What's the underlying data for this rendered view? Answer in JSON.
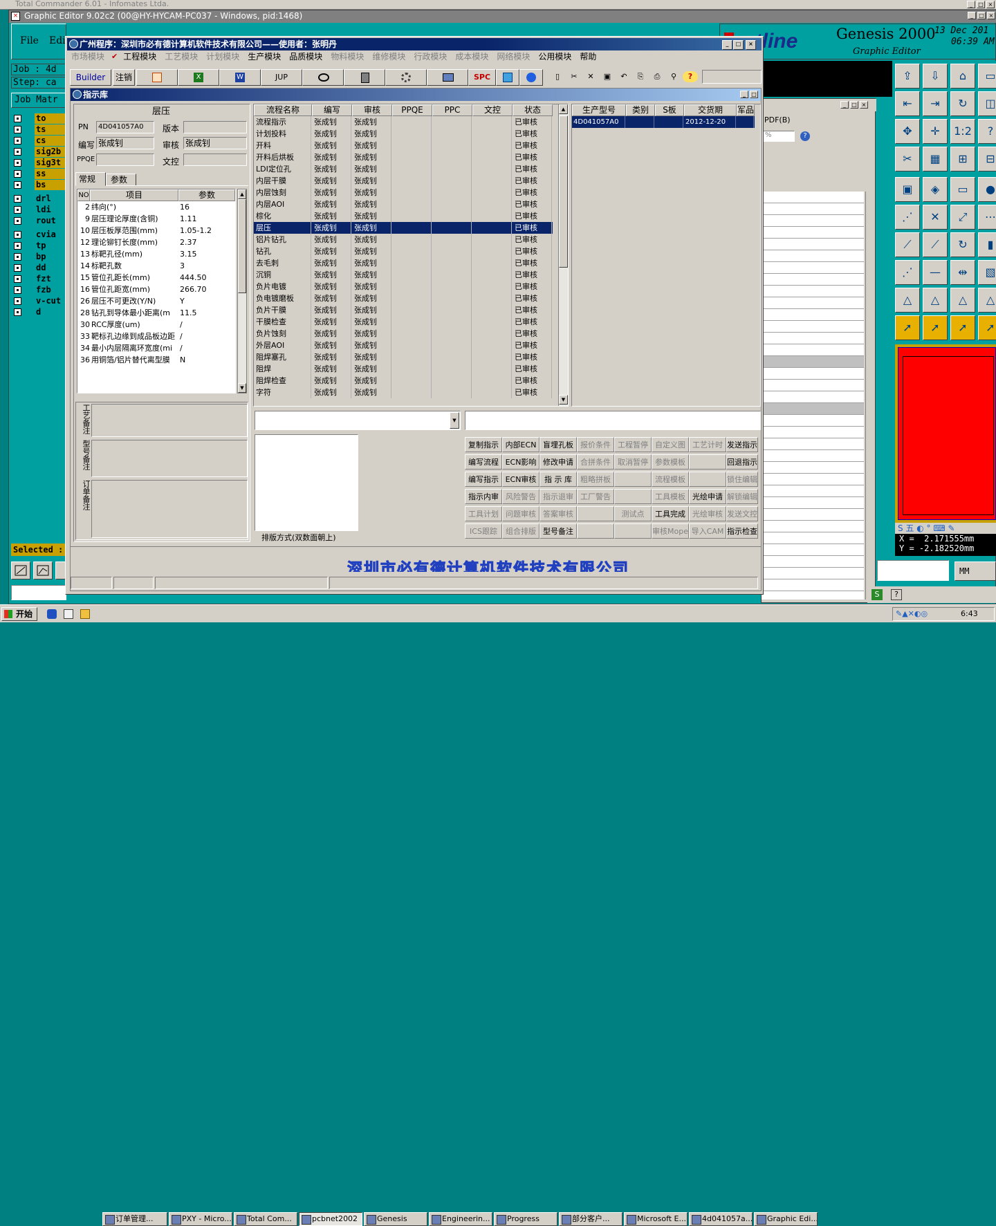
{
  "bg_window": {
    "title": "Total Commander 6.01 - Infomates Ltda."
  },
  "genesis": {
    "title": "Graphic Editor 9.02c2 (00@HY-HYCAM-PC037 - Windows, pid:1468)",
    "menu": [
      "File",
      "Edi"
    ],
    "job_label": "Job : 4d",
    "step_label": "Step: ca",
    "job_matrix": "Job Matr",
    "layers": [
      "to",
      "ts",
      "cs",
      "sig2b",
      "sig3t",
      "ss",
      "bs",
      "drl",
      "ldi",
      "rout",
      "cvia",
      "tp",
      "bp",
      "dd",
      "fzt",
      "fzb",
      "v-cut",
      "d"
    ],
    "selected": "Selected :",
    "logo": "ontline",
    "product": "Genesis 2000",
    "subtitle": "Graphic Editor",
    "date": "13 Dec 201",
    "time": "06:39 AM",
    "coord_x": "X =  2.171555mm",
    "coord_y": "Y = -2.182520mm",
    "units": "MM"
  },
  "pdf_window": {
    "label": "PDF(B)",
    "zoom": "%"
  },
  "app": {
    "title": "广州程序：深圳市必有德计算机软件技术有限公司——使用者：张明丹",
    "menu": [
      {
        "label": "市场模块",
        "enabled": false
      },
      {
        "label": "工程模块",
        "enabled": true
      },
      {
        "label": "工艺模块",
        "enabled": false
      },
      {
        "label": "计划模块",
        "enabled": false
      },
      {
        "label": "生产模块",
        "enabled": true
      },
      {
        "label": "品质模块",
        "enabled": true
      },
      {
        "label": "物料模块",
        "enabled": false
      },
      {
        "label": "维修模块",
        "enabled": false
      },
      {
        "label": "行政模块",
        "enabled": false
      },
      {
        "label": "成本模块",
        "enabled": false
      },
      {
        "label": "网络模块",
        "enabled": false
      },
      {
        "label": "公用模块",
        "enabled": true
      },
      {
        "label": "帮助",
        "enabled": true
      }
    ],
    "toolbar": {
      "builder": "Builder",
      "logout": "注销",
      "jup": "JUP",
      "spc": "SPC"
    },
    "footer": "深圳市必有德计算机软件技术有限公司"
  },
  "inner": {
    "title": "指示库",
    "section_title": "层压",
    "pn_label": "PN",
    "pn_value": "4D041057A0",
    "version_label": "版本",
    "version_value": "",
    "author_label": "编写",
    "author_value": "张成钊",
    "review_label": "审核",
    "review_value": "张成钊",
    "ppqe_label": "PPQE",
    "ppqe_value": "",
    "doc_label": "文控",
    "doc_value": "",
    "tabs": [
      "常规",
      "参数"
    ],
    "param_headers": [
      "NO",
      "项目",
      "参数"
    ],
    "params": [
      [
        "2",
        "纬向(°)",
        "16"
      ],
      [
        "9",
        "层压理论厚度(含铜)",
        "1.11"
      ],
      [
        "10",
        "层压板厚范围(mm)",
        "1.05-1.2"
      ],
      [
        "12",
        "理论铆钉长度(mm)",
        "2.37"
      ],
      [
        "13",
        "标靶孔径(mm)",
        "3.15"
      ],
      [
        "14",
        "标靶孔数",
        "3"
      ],
      [
        "15",
        "管位孔距长(mm)",
        "444.50"
      ],
      [
        "16",
        "管位孔距宽(mm)",
        "266.70"
      ],
      [
        "26",
        "层压不可更改(Y/N)",
        "Y"
      ],
      [
        "28",
        "钻孔到导体最小距离(m",
        "11.5"
      ],
      [
        "30",
        "RCC厚度(um)",
        "/"
      ],
      [
        "33",
        "靶标孔边缘到成品板边距",
        "/"
      ],
      [
        "34",
        "最小内层隔离环宽度(mi",
        "/"
      ],
      [
        "36",
        "用铜箔/铝片替代离型膜",
        "N"
      ]
    ],
    "note1": "工艺备注",
    "note2": "型号备注",
    "note3": "订单备注",
    "flow_headers": [
      "流程名称",
      "编写",
      "审核",
      "PPQE",
      "PPC",
      "文控",
      "状态"
    ],
    "flows": [
      [
        "流程指示",
        "张成钊",
        "张成钊",
        "",
        "",
        "",
        "已审核"
      ],
      [
        "计划投料",
        "张成钊",
        "张成钊",
        "",
        "",
        "",
        "已审核"
      ],
      [
        "开料",
        "张成钊",
        "张成钊",
        "",
        "",
        "",
        "已审核"
      ],
      [
        "开料后烘板",
        "张成钊",
        "张成钊",
        "",
        "",
        "",
        "已审核"
      ],
      [
        "LDI定位孔",
        "张成钊",
        "张成钊",
        "",
        "",
        "",
        "已审核"
      ],
      [
        "内层干膜",
        "张成钊",
        "张成钊",
        "",
        "",
        "",
        "已审核"
      ],
      [
        "内层蚀刻",
        "张成钊",
        "张成钊",
        "",
        "",
        "",
        "已审核"
      ],
      [
        "内层AOI",
        "张成钊",
        "张成钊",
        "",
        "",
        "",
        "已审核"
      ],
      [
        "棕化",
        "张成钊",
        "张成钊",
        "",
        "",
        "",
        "已审核"
      ],
      [
        "层压",
        "张成钊",
        "张成钊",
        "",
        "",
        "",
        "已审核"
      ],
      [
        "铝片钻孔",
        "张成钊",
        "张成钊",
        "",
        "",
        "",
        "已审核"
      ],
      [
        "钻孔",
        "张成钊",
        "张成钊",
        "",
        "",
        "",
        "已审核"
      ],
      [
        "去毛刺",
        "张成钊",
        "张成钊",
        "",
        "",
        "",
        "已审核"
      ],
      [
        "沉铜",
        "张成钊",
        "张成钊",
        "",
        "",
        "",
        "已审核"
      ],
      [
        "负片电镀",
        "张成钊",
        "张成钊",
        "",
        "",
        "",
        "已审核"
      ],
      [
        "负电镀磨板",
        "张成钊",
        "张成钊",
        "",
        "",
        "",
        "已审核"
      ],
      [
        "负片干膜",
        "张成钊",
        "张成钊",
        "",
        "",
        "",
        "已审核"
      ],
      [
        "干膜检查",
        "张成钊",
        "张成钊",
        "",
        "",
        "",
        "已审核"
      ],
      [
        "负片蚀刻",
        "张成钊",
        "张成钊",
        "",
        "",
        "",
        "已审核"
      ],
      [
        "外层AOI",
        "张成钊",
        "张成钊",
        "",
        "",
        "",
        "已审核"
      ],
      [
        "阻焊塞孔",
        "张成钊",
        "张成钊",
        "",
        "",
        "",
        "已审核"
      ],
      [
        "阻焊",
        "张成钊",
        "张成钊",
        "",
        "",
        "",
        "已审核"
      ],
      [
        "阻焊检查",
        "张成钊",
        "张成钊",
        "",
        "",
        "",
        "已审核"
      ],
      [
        "字符",
        "张成钊",
        "张成钊",
        "",
        "",
        "",
        "已审核"
      ]
    ],
    "selected_flow": 9,
    "model_headers": [
      "生产型号",
      "类别",
      "S板",
      "交货期",
      "军品"
    ],
    "models": [
      [
        "4D041057A0",
        "",
        "",
        "2012-12-20",
        ""
      ]
    ],
    "sort_label": "排版方式(双数面朝上)",
    "actions": [
      [
        [
          "复制指示",
          1
        ],
        [
          "内部ECN",
          1
        ],
        [
          "盲埋孔板",
          1
        ],
        [
          "报价条件",
          0
        ],
        [
          "工程暂停",
          0
        ],
        [
          "自定义图",
          0
        ],
        [
          "工艺计时",
          0
        ],
        [
          "发送指示",
          1
        ]
      ],
      [
        [
          "编写流程",
          1
        ],
        [
          "ECN影响",
          1
        ],
        [
          "修改申请",
          1
        ],
        [
          "合拼条件",
          0
        ],
        [
          "取消暂停",
          0
        ],
        [
          "参数模板",
          0
        ],
        [
          "",
          0
        ],
        [
          "回退指示",
          1
        ]
      ],
      [
        [
          "编写指示",
          1
        ],
        [
          "ECN审核",
          1
        ],
        [
          "指 示 库",
          1
        ],
        [
          "粗略拼板",
          0
        ],
        [
          "",
          0
        ],
        [
          "流程模板",
          0
        ],
        [
          "",
          0
        ],
        [
          "锁住编辑",
          0
        ]
      ],
      [
        [
          "指示内审",
          1
        ],
        [
          "风险警告",
          0
        ],
        [
          "指示退审",
          0
        ],
        [
          "工厂警告",
          0
        ],
        [
          "",
          0
        ],
        [
          "工具模板",
          0
        ],
        [
          "光绘申请",
          1
        ],
        [
          "解锁编辑",
          0
        ]
      ],
      [
        [
          "工具计划",
          0
        ],
        [
          "问题审核",
          0
        ],
        [
          "答案审核",
          0
        ],
        [
          "",
          0
        ],
        [
          "测试点",
          0
        ],
        [
          "工具完成",
          1
        ],
        [
          "光绘审核",
          0
        ],
        [
          "发送文控",
          0
        ]
      ],
      [
        [
          "ICS跟踪",
          0
        ],
        [
          "组合排版",
          0
        ],
        [
          "型号备注",
          1
        ],
        [
          "",
          0
        ],
        [
          "",
          0
        ],
        [
          "审核Mope",
          0
        ],
        [
          "导入CAM",
          0
        ],
        [
          "指示检查",
          1
        ]
      ]
    ]
  },
  "taskbar": {
    "start": "开始",
    "items": [
      "订单管理...",
      "PXY - Micro...",
      "Total Com...",
      "pcbnet2002",
      "Genesis",
      "Engineerin...",
      "Progress",
      "部分客户...",
      "Microsoft E...",
      "4d041057a...",
      "Graphic Edi..."
    ],
    "clock": "6:43"
  },
  "colors": {
    "accent": "#0a246a",
    "genesis_layer": "#c8a000",
    "genesis_bg": "#00a0a0",
    "status_ok": "#000000"
  }
}
